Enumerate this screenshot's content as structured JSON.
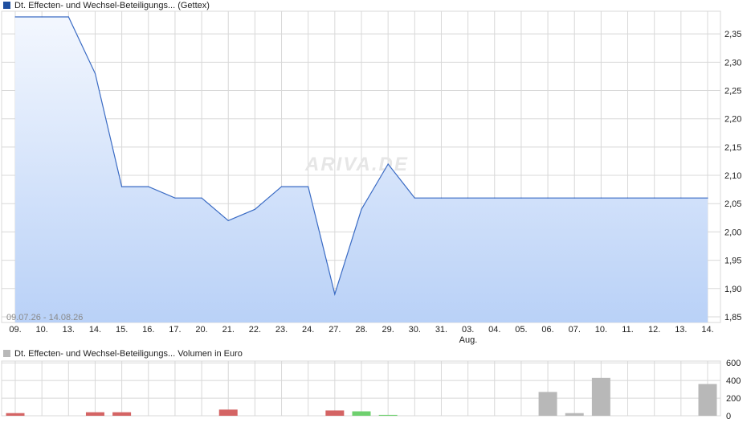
{
  "chart_title": "Dt. Effecten- und Wechsel-Beteiligungs... (Gettex)",
  "volume_title": "Dt. Effecten- und Wechsel-Beteiligungs... Volumen in Euro",
  "date_range": "09.07.26 - 14.08.26",
  "watermark": "ARIVA.DE",
  "month_label": "Aug.",
  "colors": {
    "line": "#3a6bc4",
    "fill_top": "#f3f7fe",
    "fill_bottom": "#b9d1f7",
    "grid": "#d8d8d8",
    "vol_up": "#6fd06f",
    "vol_down": "#d46464",
    "vol_neutral": "#b8b8b8",
    "legend_main": "#1f4fa0",
    "legend_vol": "#b8b8b8"
  },
  "chart_data": [
    {
      "type": "area",
      "title": "Dt. Effecten- und Wechsel-Beteiligungs... (Gettex)",
      "x": [
        "09.",
        "10.",
        "13.",
        "14.",
        "15.",
        "16.",
        "17.",
        "20.",
        "21.",
        "22.",
        "23.",
        "24.",
        "27.",
        "28.",
        "29.",
        "30.",
        "31.",
        "03.",
        "04.",
        "05.",
        "06.",
        "07.",
        "10.",
        "11.",
        "12.",
        "13.",
        "14."
      ],
      "values": [
        2.38,
        2.38,
        2.38,
        2.28,
        2.08,
        2.08,
        2.06,
        2.06,
        2.02,
        2.04,
        2.08,
        2.08,
        1.89,
        2.04,
        2.12,
        2.06,
        2.06,
        2.06,
        2.06,
        2.06,
        2.06,
        2.06,
        2.06,
        2.06,
        2.06,
        2.06,
        2.06
      ],
      "ylim": [
        1.84,
        2.39
      ],
      "yticks": [
        "2,35",
        "2,30",
        "2,25",
        "2,20",
        "2,15",
        "2,10",
        "2,05",
        "2,00",
        "1,95",
        "1,90",
        "1,85"
      ],
      "ytick_values": [
        2.35,
        2.3,
        2.25,
        2.2,
        2.15,
        2.1,
        2.05,
        2.0,
        1.95,
        1.9,
        1.85
      ],
      "grid": true
    },
    {
      "type": "bar",
      "title": "Dt. Effecten- und Wechsel-Beteiligungs... Volumen in Euro",
      "x": [
        "09.",
        "10.",
        "13.",
        "14.",
        "15.",
        "16.",
        "17.",
        "20.",
        "21.",
        "22.",
        "23.",
        "24.",
        "27.",
        "28.",
        "29.",
        "30.",
        "31.",
        "03.",
        "04.",
        "05.",
        "06.",
        "07.",
        "10.",
        "11.",
        "12.",
        "13.",
        "14."
      ],
      "values": [
        30,
        0,
        0,
        40,
        40,
        0,
        0,
        0,
        70,
        0,
        0,
        0,
        60,
        50,
        10,
        0,
        0,
        0,
        0,
        0,
        270,
        30,
        430,
        0,
        0,
        0,
        360
      ],
      "directions": [
        "down",
        "none",
        "none",
        "down",
        "down",
        "none",
        "none",
        "none",
        "down",
        "none",
        "none",
        "none",
        "down",
        "up",
        "up",
        "none",
        "none",
        "none",
        "none",
        "none",
        "neutral",
        "neutral",
        "neutral",
        "none",
        "none",
        "none",
        "neutral"
      ],
      "ylim": [
        0,
        620
      ],
      "yticks": [
        "600",
        "400",
        "200",
        "0"
      ],
      "ytick_values": [
        600,
        400,
        200,
        0
      ],
      "grid": true
    }
  ]
}
